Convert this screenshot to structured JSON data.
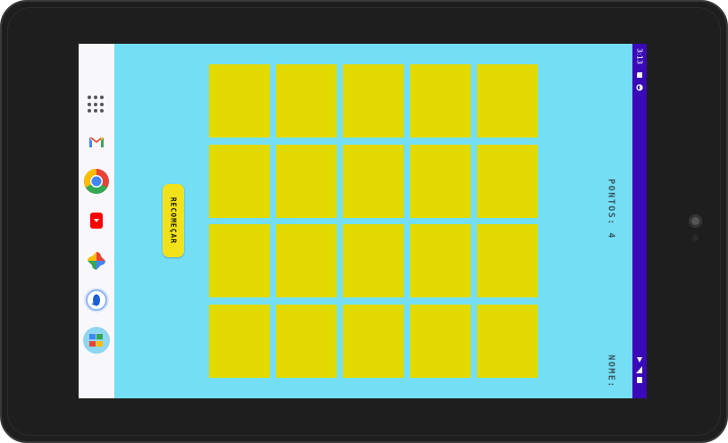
{
  "status_bar": {
    "time": "3:13",
    "icons": [
      "sd-card-icon",
      "sync-icon",
      "wifi-icon",
      "signal-icon",
      "battery-icon"
    ],
    "color": "#3a0ab8"
  },
  "taskbar": {
    "apps": [
      {
        "name": "all-apps-icon"
      },
      {
        "name": "gmail-icon"
      },
      {
        "name": "chrome-icon"
      },
      {
        "name": "youtube-icon"
      },
      {
        "name": "photos-icon"
      },
      {
        "name": "assistant-icon"
      },
      {
        "name": "files-icon"
      }
    ]
  },
  "game": {
    "background": "#74def5",
    "card_color": "#e2da00",
    "restart_label": "RECOMEÇAR",
    "points_label": "PONTOS: 4",
    "name_label": "NOME:",
    "grid": {
      "rows": 4,
      "cols": 5
    }
  }
}
